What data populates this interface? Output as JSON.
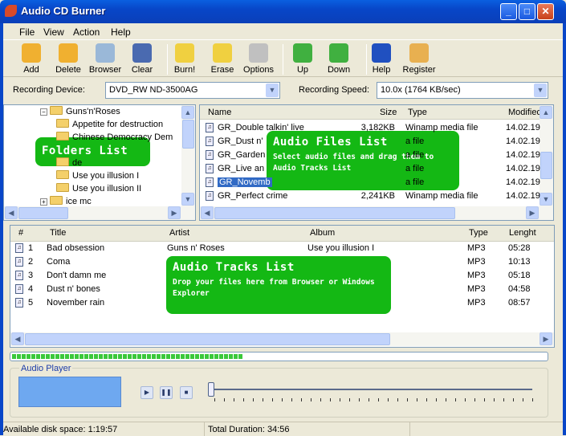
{
  "window": {
    "title": "Audio CD Burner",
    "min": "_",
    "max": "□",
    "close": "✕"
  },
  "menu": [
    "File",
    "View",
    "Action",
    "Help"
  ],
  "toolbar": [
    {
      "label": "Add",
      "icon": "add-icon",
      "color": "#f0b030"
    },
    {
      "label": "Delete",
      "icon": "delete-icon",
      "color": "#f0b030"
    },
    {
      "label": "Browser",
      "icon": "browser-icon",
      "color": "#9ab8d8"
    },
    {
      "label": "Clear",
      "icon": "clear-icon",
      "color": "#4a6ab0"
    },
    {
      "label": "Burn!",
      "icon": "burn-icon",
      "color": "#f0d040"
    },
    {
      "label": "Erase",
      "icon": "erase-icon",
      "color": "#f0d040"
    },
    {
      "label": "Options",
      "icon": "options-icon",
      "color": "#c0c0c0"
    },
    {
      "label": "Up",
      "icon": "up-arrow-icon",
      "color": "#40b040"
    },
    {
      "label": "Down",
      "icon": "down-arrow-icon",
      "color": "#40b040"
    },
    {
      "label": "Help",
      "icon": "help-icon",
      "color": "#2050c0"
    },
    {
      "label": "Register",
      "icon": "lock-icon",
      "color": "#e8b050"
    }
  ],
  "recording": {
    "device_label": "Recording Device:",
    "device": "DVD_RW ND-3500AG",
    "speed_label": "Recording Speed:",
    "speed": "10.0x (1764 KB/sec)"
  },
  "folders": {
    "items": [
      "Guns'n'Roses",
      "Appetite for destruction",
      "Chinese Democracy Dem",
      "",
      "de",
      "Use you illusion I",
      "Use you illusion II",
      "ice mc"
    ]
  },
  "files": {
    "columns": [
      "Name",
      "Size",
      "Type",
      "Modified"
    ],
    "rows": [
      {
        "name": "GR_Double talkin' live",
        "size": "3,182KB",
        "type": "Winamp media file",
        "modified": "14.02.19"
      },
      {
        "name": "GR_Dust n'",
        "size": "",
        "type": "a file",
        "modified": "14.02.19"
      },
      {
        "name": "GR_Garden",
        "size": "",
        "type": "a file",
        "modified": "14.02.19"
      },
      {
        "name": "GR_Live an",
        "size": "",
        "type": "a file",
        "modified": "14.02.19"
      },
      {
        "name": "GR_Novemb",
        "size": "",
        "type": "a file",
        "modified": "14.02.19"
      },
      {
        "name": "GR_Perfect crime",
        "size": "2,241KB",
        "type": "Winamp media file",
        "modified": "14.02.19"
      }
    ]
  },
  "tracks": {
    "columns": [
      "#",
      "Title",
      "Artist",
      "Album",
      "Type",
      "Lenght"
    ],
    "rows": [
      {
        "n": "1",
        "title": "Bad obsession",
        "artist": "Guns n' Roses",
        "album": "Use you illusion I",
        "type": "MP3",
        "length": "05:28"
      },
      {
        "n": "2",
        "title": "Coma",
        "artist": "",
        "album": "",
        "type": "MP3",
        "length": "10:13"
      },
      {
        "n": "3",
        "title": "Don't damn me",
        "artist": "",
        "album": "",
        "type": "MP3",
        "length": "05:18"
      },
      {
        "n": "4",
        "title": "Dust n' bones",
        "artist": "",
        "album": "",
        "type": "MP3",
        "length": "04:58"
      },
      {
        "n": "5",
        "title": "November rain",
        "artist": "",
        "album": "",
        "type": "MP3",
        "length": "08:57"
      }
    ]
  },
  "overlays": {
    "folders": {
      "title": "Folders List"
    },
    "files": {
      "title": "Audio Files List",
      "subtitle": "Select audio files and drag them to Audio Tracks List"
    },
    "tracks": {
      "title": "Audio Tracks List",
      "subtitle": "Drop your files here from Browser or Windows Explorer"
    }
  },
  "progress_percent": 44,
  "player": {
    "label": "Audio Player",
    "position_percent": 0
  },
  "status": {
    "disk": "Available disk space: 1:19:57",
    "duration": "Total Duration: 34:56"
  }
}
